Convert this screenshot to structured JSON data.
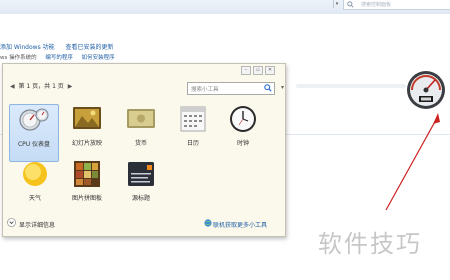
{
  "topbar": {
    "search_placeholder": "搜索控制面板"
  },
  "control_panel": {
    "row1_links": [
      "添加 Windows 功能",
      "查看已安装的更新"
    ],
    "row2_prefix": "ws 操作系统的",
    "row2_links": [
      "编写的程序",
      "如何安装程序"
    ]
  },
  "gadget_window": {
    "pager": "第 1 页，共 1 页",
    "search_placeholder": "搜索小工具",
    "gadgets": [
      {
        "label": "CPU 仪表盘",
        "icon": "cpu-meter-icon"
      },
      {
        "label": "幻灯片放映",
        "icon": "slideshow-icon"
      },
      {
        "label": "货币",
        "icon": "currency-icon"
      },
      {
        "label": "日历",
        "icon": "calendar-icon"
      },
      {
        "label": "时钟",
        "icon": "clock-icon"
      },
      {
        "label": "天气",
        "icon": "weather-icon"
      },
      {
        "label": "图片拼图板",
        "icon": "picture-puzzle-icon"
      },
      {
        "label": "源标题",
        "icon": "feed-headlines-icon"
      }
    ],
    "show_details": "显示详细信息",
    "get_more_online": "联机获取更多小工具"
  },
  "watermark": "软件技巧",
  "colors": {
    "link": "#1f5fa6",
    "window_bg": "#fbf8ec",
    "arrow": "#cc2222"
  }
}
